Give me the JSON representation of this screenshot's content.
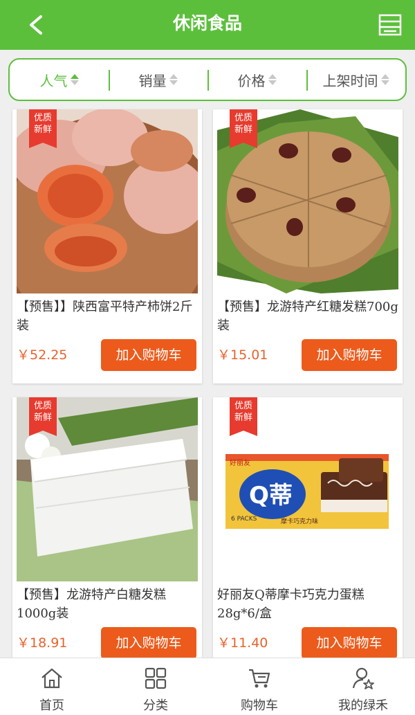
{
  "header": {
    "title": "休闲食品",
    "back_icon": "chevron-left-icon",
    "menu_icon": "list-menu-icon"
  },
  "sort": [
    {
      "label": "人气",
      "active": true
    },
    {
      "label": "销量",
      "active": false
    },
    {
      "label": "价格",
      "active": false
    },
    {
      "label": "上架时间",
      "active": false
    }
  ],
  "products": [
    {
      "badge_line1": "优质",
      "badge_line2": "新鲜",
      "name": "【预售】】陕西富平特产柿饼2斤装",
      "price": "￥52.25",
      "cart_label": "加入购物车",
      "image": "persimmon-cake"
    },
    {
      "badge_line1": "优质",
      "badge_line2": "新鲜",
      "name": "【预售】龙游特产红糖发糕700g装",
      "price": "￥15.01",
      "cart_label": "加入购物车",
      "image": "brown-sugar-cake"
    },
    {
      "badge_line1": "优质",
      "badge_line2": "新鲜",
      "name": "【预售】龙游特产白糖发糕1000g装",
      "price": "￥18.91",
      "cart_label": "加入购物车",
      "image": "white-sugar-cake"
    },
    {
      "badge_line1": "优质",
      "badge_line2": "新鲜",
      "name": "好丽友Q蒂摩卡巧克力蛋糕28g*6/盒",
      "price": "￥11.40",
      "cart_label": "加入购物车",
      "image": "q-di-chocolate-cake-box",
      "box_brand": "好丽友",
      "box_logo": "Q蒂",
      "box_packs": "6 PACKS",
      "box_flavor": "摩卡巧克力味"
    }
  ],
  "tabs": [
    {
      "label": "首页",
      "icon": "home-icon"
    },
    {
      "label": "分类",
      "icon": "grid-icon"
    },
    {
      "label": "购物车",
      "icon": "cart-icon"
    },
    {
      "label": "我的绿禾",
      "icon": "user-star-icon"
    }
  ],
  "colors": {
    "brand_green": "#5cbf3c",
    "price_orange": "#e8622c",
    "button_orange": "#ec5b1c",
    "badge_red": "#e63b2e"
  }
}
